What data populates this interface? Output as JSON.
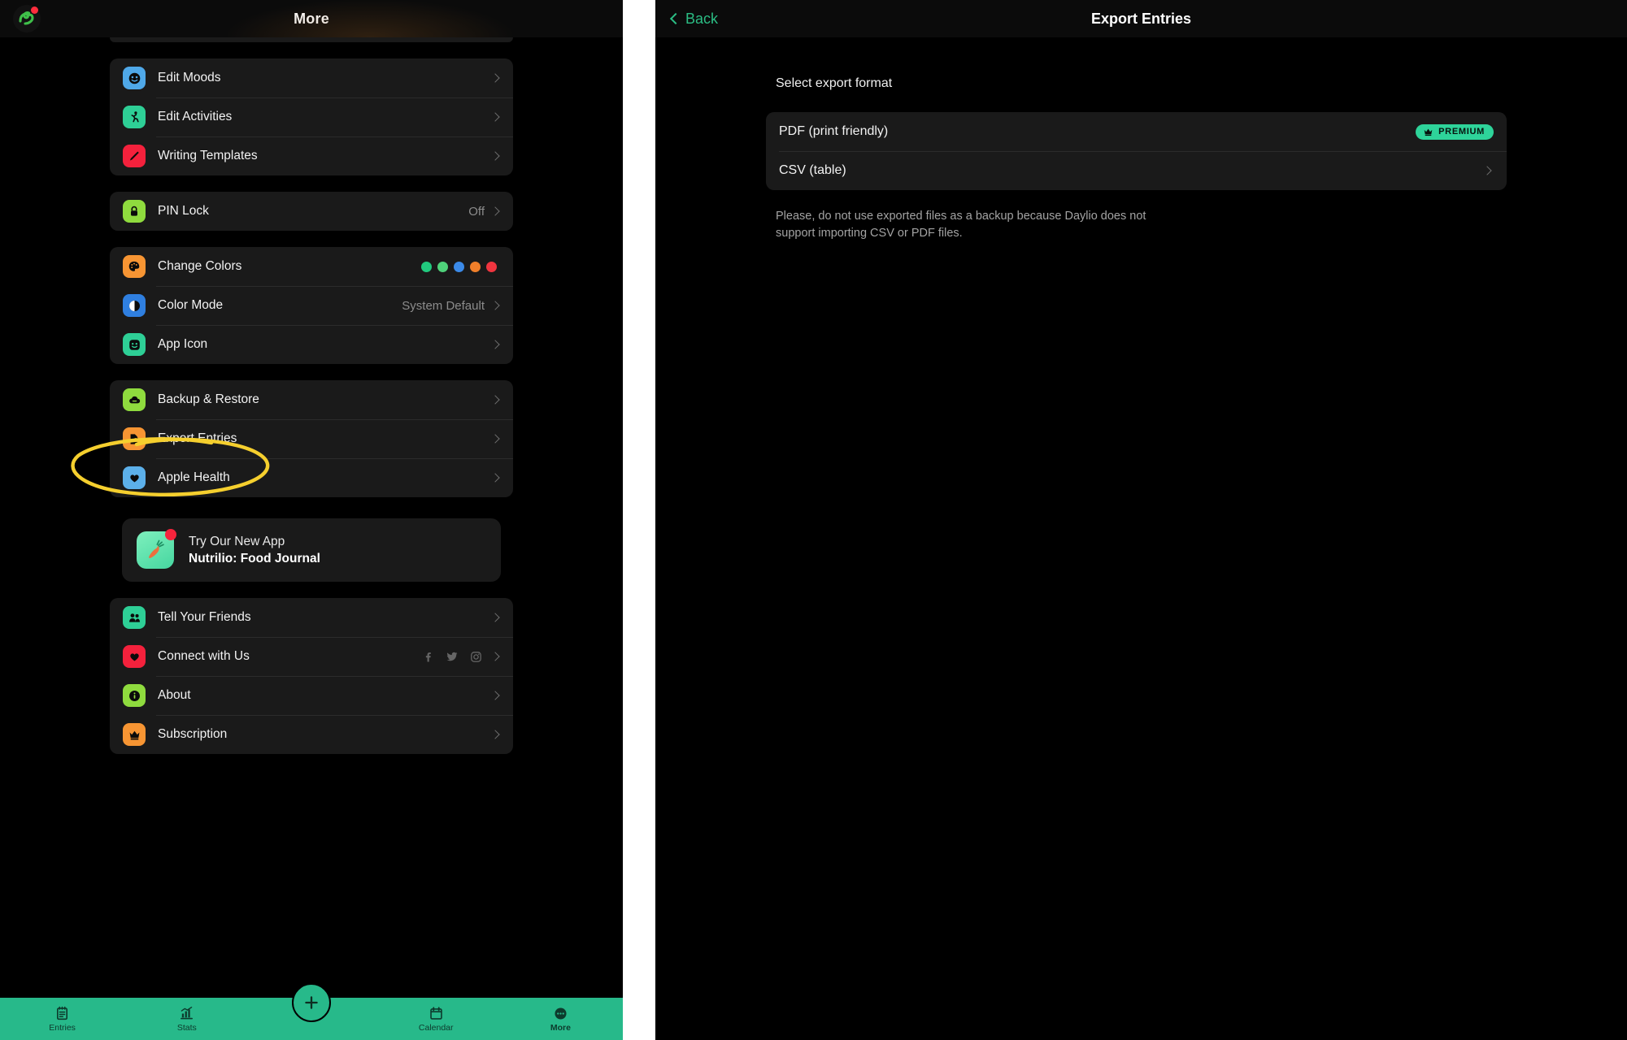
{
  "left": {
    "header": {
      "title": "More",
      "logo_icon": "daylio-logo-icon",
      "badge_icon": "notification-dot-icon"
    },
    "groups": [
      {
        "id": "editors",
        "rows": [
          {
            "label": "Edit Moods",
            "icon": "smiley-face-icon",
            "icon_bg": "#4fa8e8",
            "chevron": true
          },
          {
            "label": "Edit Activities",
            "icon": "running-person-icon",
            "icon_bg": "#2ecf96",
            "chevron": true
          },
          {
            "label": "Writing Templates",
            "icon": "pencil-icon",
            "icon_bg": "#f4213c",
            "chevron": true
          }
        ]
      },
      {
        "id": "security",
        "rows": [
          {
            "label": "PIN Lock",
            "icon": "padlock-icon",
            "icon_bg": "#8fdb3e",
            "value": "Off",
            "chevron": true
          }
        ]
      },
      {
        "id": "appearance",
        "rows": [
          {
            "label": "Change Colors",
            "icon": "palette-icon",
            "icon_bg": "#f79533",
            "chevron": false,
            "swatches": [
              "#21c97e",
              "#4fd17a",
              "#3b8ae8",
              "#f07f2a",
              "#f0353f"
            ]
          },
          {
            "label": "Color Mode",
            "icon": "half-circle-contrast-icon",
            "icon_bg": "#2f7fe0",
            "value": "System Default",
            "chevron": true
          },
          {
            "label": "App Icon",
            "icon": "app-face-icon",
            "icon_bg": "#2ecf96",
            "chevron": true
          }
        ]
      },
      {
        "id": "data",
        "rows": [
          {
            "label": "Backup & Restore",
            "icon": "cloud-icon",
            "icon_bg": "#8fdb3e",
            "chevron": true
          },
          {
            "label": "Export Entries",
            "icon": "export-file-icon",
            "icon_bg": "#f79533",
            "chevron": true,
            "highlighted": true
          },
          {
            "label": "Apple Health",
            "icon": "heart-icon",
            "icon_bg": "#5cb0ea",
            "chevron": true
          }
        ]
      },
      {
        "id": "community",
        "rows": [
          {
            "label": "Tell Your Friends",
            "icon": "two-people-icon",
            "icon_bg": "#2ecf96",
            "chevron": true
          },
          {
            "label": "Connect with Us",
            "icon": "heart-icon",
            "icon_bg": "#f4213c",
            "chevron": true,
            "socials": [
              "facebook-icon",
              "twitter-icon",
              "instagram-icon"
            ]
          },
          {
            "label": "About",
            "icon": "info-icon",
            "icon_bg": "#8fdb3e",
            "chevron": true
          },
          {
            "label": "Subscription",
            "icon": "crown-icon",
            "icon_bg": "#f79533",
            "chevron": true
          }
        ]
      }
    ],
    "promo": {
      "line1": "Try Our New App",
      "line2": "Nutrilio: Food Journal",
      "icon": "carrot-icon",
      "badge_icon": "new-dot-icon"
    },
    "annotation": {
      "type": "yellow-ellipse-highlight",
      "target": "Export Entries",
      "color": "#f5cf2e"
    },
    "tabbar": {
      "bg_color": "#27b98a",
      "tabs": [
        {
          "label": "Entries",
          "icon": "notebook-icon",
          "active": false
        },
        {
          "label": "Stats",
          "icon": "bar-chart-icon",
          "active": false
        },
        {
          "label": "Calendar",
          "icon": "calendar-icon",
          "active": false
        },
        {
          "label": "More",
          "icon": "ellipsis-icon",
          "active": true
        }
      ],
      "fab": {
        "icon": "plus-icon",
        "label": "+"
      }
    }
  },
  "right": {
    "header": {
      "back_label": "Back",
      "back_icon": "chevron-left-icon",
      "title": "Export Entries",
      "accent_color": "#2bbd84"
    },
    "section_label": "Select export format",
    "options": [
      {
        "label": "PDF (print friendly)",
        "badge": "PREMIUM",
        "badge_icon": "crown-icon",
        "badge_color": "#2ed49a",
        "chevron": false
      },
      {
        "label": "CSV (table)",
        "chevron": true
      }
    ],
    "disclaimer": "Please, do not use exported files as a backup because Daylio does not support importing CSV or PDF files."
  }
}
